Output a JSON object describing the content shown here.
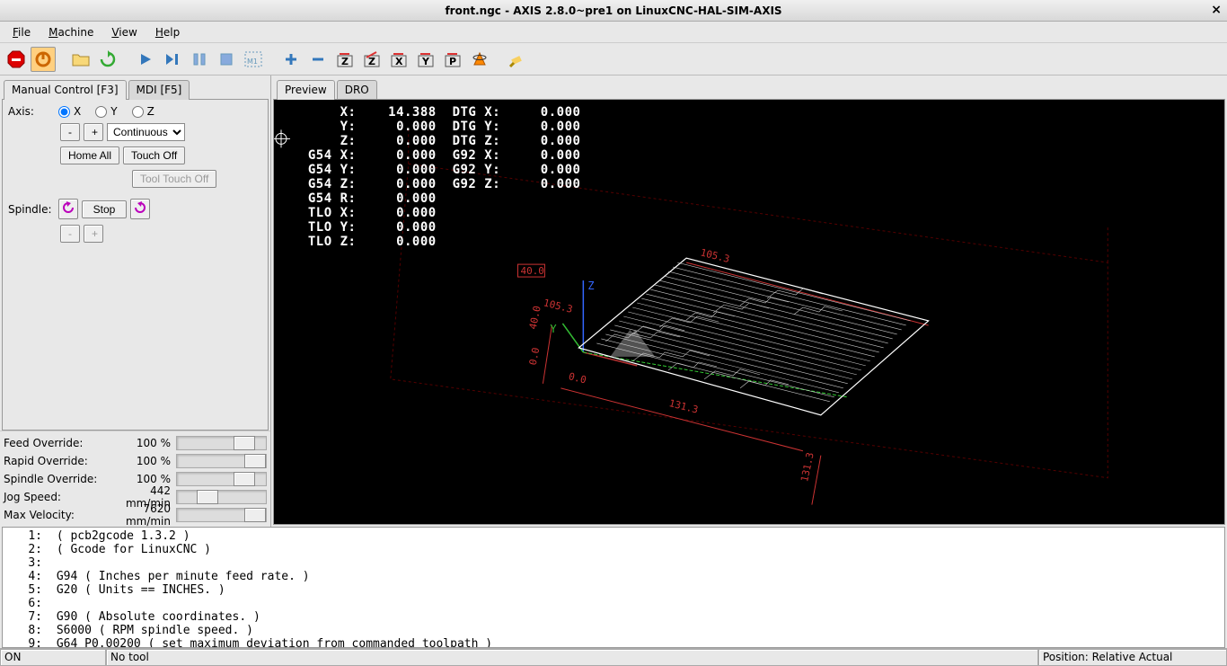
{
  "title": "front.ngc - AXIS 2.8.0~pre1 on LinuxCNC-HAL-SIM-AXIS",
  "menu": {
    "file": "File",
    "machine": "Machine",
    "view": "View",
    "help": "Help"
  },
  "tabs_left": {
    "manual": "Manual Control [F3]",
    "mdi": "MDI [F5]"
  },
  "tabs_right": {
    "preview": "Preview",
    "dro": "DRO"
  },
  "axis": {
    "label": "Axis:",
    "x": "X",
    "y": "Y",
    "z": "Z",
    "minus": "-",
    "plus": "+",
    "mode": "Continuous",
    "home": "Home All",
    "touch": "Touch Off",
    "tooltouch": "Tool Touch Off"
  },
  "spindle": {
    "label": "Spindle:",
    "stop": "Stop",
    "minus": "-",
    "plus": "+"
  },
  "overrides": {
    "feed": {
      "label": "Feed Override:",
      "value": "100 %"
    },
    "rapid": {
      "label": "Rapid Override:",
      "value": "100 %"
    },
    "spin": {
      "label": "Spindle Override:",
      "value": "100 %"
    },
    "jog": {
      "label": "Jog Speed:",
      "value": "442 mm/min"
    },
    "maxv": {
      "label": "Max Velocity:",
      "value": "7620 mm/min"
    }
  },
  "overlay_text": "      X:    14.388  DTG X:     0.000\n      Y:     0.000  DTG Y:     0.000\n      Z:     0.000  DTG Z:     0.000\n  G54 X:     0.000  G92 X:     0.000\n  G54 Y:     0.000  G92 Y:     0.000\n  G54 Z:     0.000  G92 Z:     0.000\n  G54 R:     0.000\n  TLO X:     0.000\n  TLO Y:     0.000\n  TLO Z:     0.000",
  "viewport_labels": {
    "z": "Z",
    "y": "Y",
    "d40": "40.0",
    "d40b": "40.0",
    "d00": "0.0",
    "d00b": "0.0",
    "d131": "131.3",
    "d131b": "131.3",
    "d105": "105.3",
    "d105b": "105.3"
  },
  "gcode": [
    "( pcb2gcode 1.3.2 )",
    "( Gcode for LinuxCNC )",
    "",
    "G94 ( Inches per minute feed rate. )",
    "G20 ( Units == INCHES. )",
    "",
    "G90 ( Absolute coordinates. )",
    "S6000 ( RPM spindle speed. )",
    "G64 P0.00200 ( set maximum deviation from commanded toolpath )"
  ],
  "status": {
    "on": "ON",
    "tool": "No tool",
    "pos": "Position: Relative Actual"
  }
}
